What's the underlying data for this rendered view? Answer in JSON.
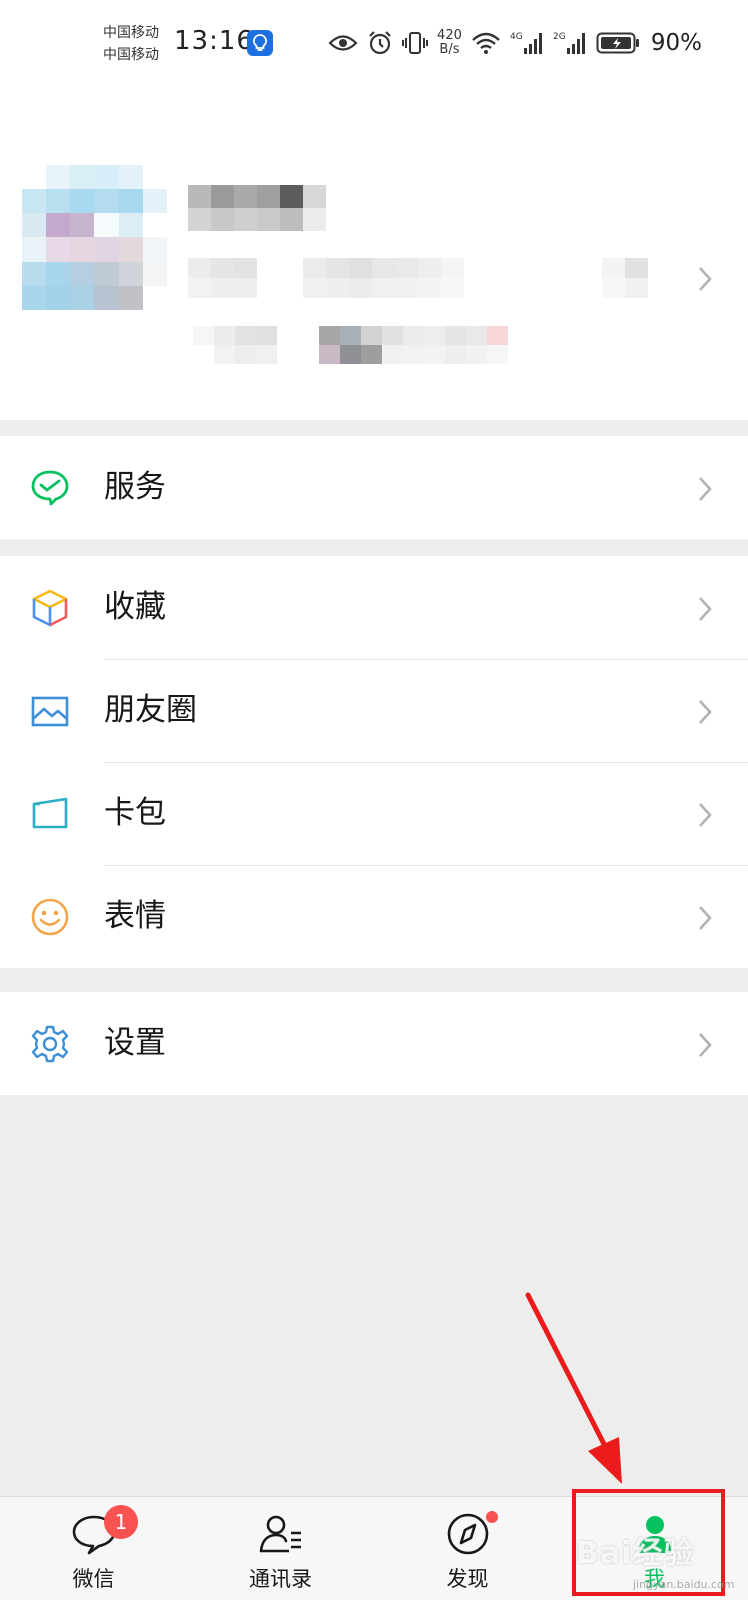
{
  "status_bar": {
    "carrier_1": "中国移动",
    "carrier_2": "中国移动",
    "time": "13:16",
    "speed_value": "420",
    "speed_unit": "B/s",
    "net_1": "4G",
    "net_2": "2G",
    "battery_percent": "90%",
    "icons": [
      "eye-icon",
      "alarm-icon",
      "vibrate-icon",
      "wifi-icon",
      "signal-icon",
      "battery-icon"
    ]
  },
  "profile": {
    "avatar": "blurred-avatar",
    "nickname": "",
    "wechat_id": ""
  },
  "menu": {
    "service": "服务",
    "favorites": "收藏",
    "moments": "朋友圈",
    "cards": "卡包",
    "stickers": "表情",
    "settings": "设置"
  },
  "tab_bar": {
    "chats": "微信",
    "chats_unread": "1",
    "contacts": "通讯录",
    "discover": "发现",
    "me": "我",
    "active_tab": "me"
  },
  "colors": {
    "brand_green": "#07c160",
    "badge_red": "#fa5151",
    "annotation_red": "#ec1b1b"
  },
  "watermark": {
    "text": "Bai经验",
    "sub": "jingyan.baidu.com"
  }
}
